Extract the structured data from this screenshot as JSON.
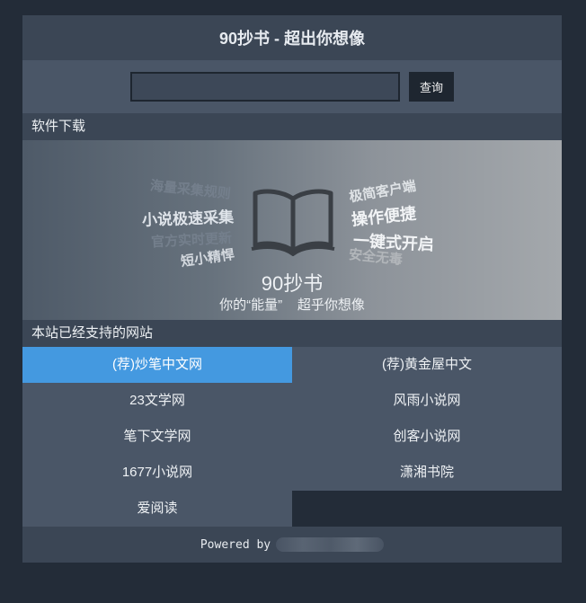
{
  "header": {
    "title": "90抄书 - 超出你想像"
  },
  "search": {
    "value": "",
    "placeholder": "",
    "button_label": "查询"
  },
  "download_section": {
    "title": "软件下载"
  },
  "banner": {
    "left_tags": [
      "海量采集规则",
      "小说极速采集",
      "官方实时更新",
      "短小精悍"
    ],
    "right_tags": [
      "极简客户端",
      "操作便捷",
      "一键式开启",
      "安全无毒"
    ],
    "brand": "90抄书",
    "slogan": "你的“能量”    超乎你想像",
    "icon": "open-book-icon"
  },
  "sites_section": {
    "title": "本站已经支持的网站",
    "items": [
      {
        "label": "(荐)炒笔中文网",
        "active": true
      },
      {
        "label": "(荐)黄金屋中文",
        "active": false
      },
      {
        "label": "23文学网",
        "active": false
      },
      {
        "label": "风雨小说网",
        "active": false
      },
      {
        "label": "笔下文学网",
        "active": false
      },
      {
        "label": "创客小说网",
        "active": false
      },
      {
        "label": "1677小说网",
        "active": false
      },
      {
        "label": "潇湘书院",
        "active": false
      },
      {
        "label": "爱阅读",
        "active": false
      }
    ]
  },
  "footer": {
    "text": "Powered by"
  },
  "colors": {
    "background": "#232c38",
    "panel": "#455263",
    "accent": "#4499e0"
  }
}
